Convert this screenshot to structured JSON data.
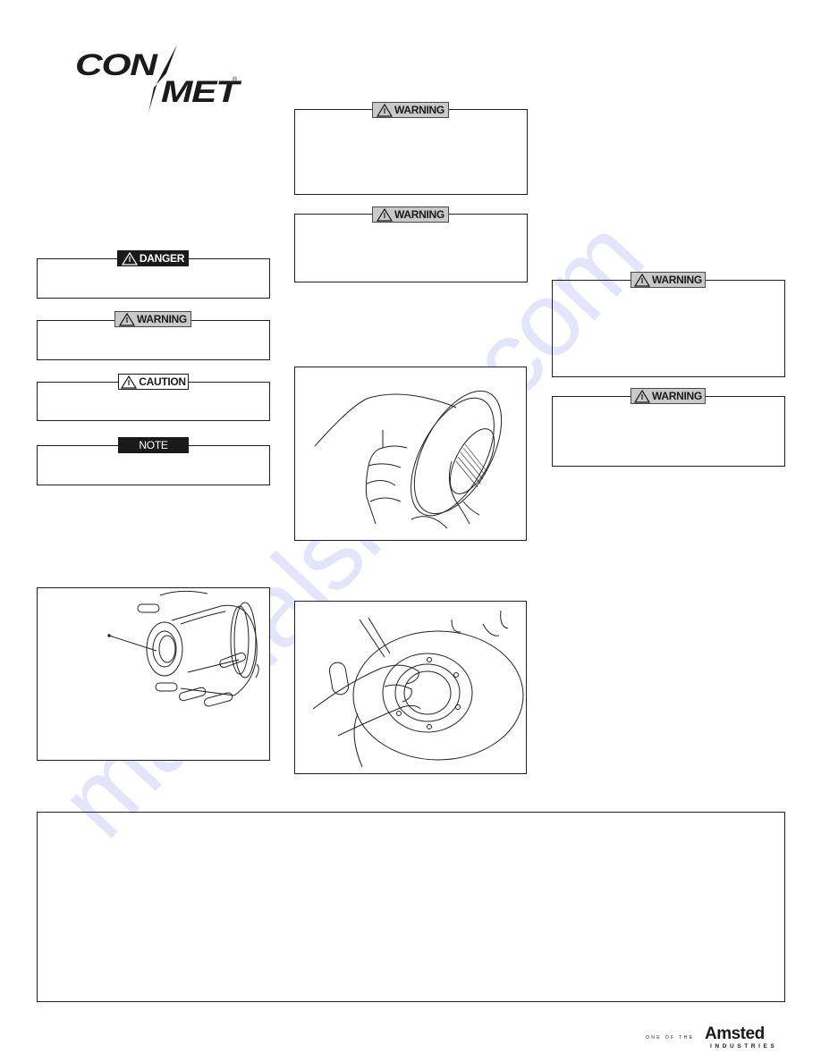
{
  "document": {
    "logo": {
      "primary": "CON",
      "secondary": "MET",
      "registered": "®"
    },
    "notice_legend": [
      {
        "type": "danger",
        "label": "DANGER",
        "icon": "warning-triangle-icon"
      },
      {
        "type": "warning",
        "label": "WARNING",
        "icon": "warning-triangle-icon"
      },
      {
        "type": "caution",
        "label": "CAUTION",
        "icon": "warning-triangle-icon"
      },
      {
        "type": "note",
        "label": "NOTE",
        "icon": ""
      }
    ],
    "middle_notices": [
      {
        "type": "warning",
        "label": "WARNING",
        "icon": "warning-triangle-icon"
      },
      {
        "type": "warning",
        "label": "WARNING",
        "icon": "warning-triangle-icon"
      }
    ],
    "right_notices": [
      {
        "type": "warning",
        "label": "WARNING",
        "icon": "warning-triangle-icon"
      },
      {
        "type": "warning",
        "label": "WARNING",
        "icon": "warning-triangle-icon"
      }
    ],
    "figures": [
      {
        "name": "hub-assembly-illustration",
        "description": "Wheel hub assembly with callout leader line"
      },
      {
        "name": "tone-ring-in-hand-illustration",
        "description": "Hand holding toothed ABS tone ring"
      },
      {
        "name": "seal-installation-illustration",
        "description": "Hand installing component into hub bore"
      }
    ],
    "watermark": "manualshive.com",
    "footer": {
      "prefix": "ONE OF THE",
      "brand": "Amsted",
      "subtitle": "INDUSTRIES"
    }
  }
}
